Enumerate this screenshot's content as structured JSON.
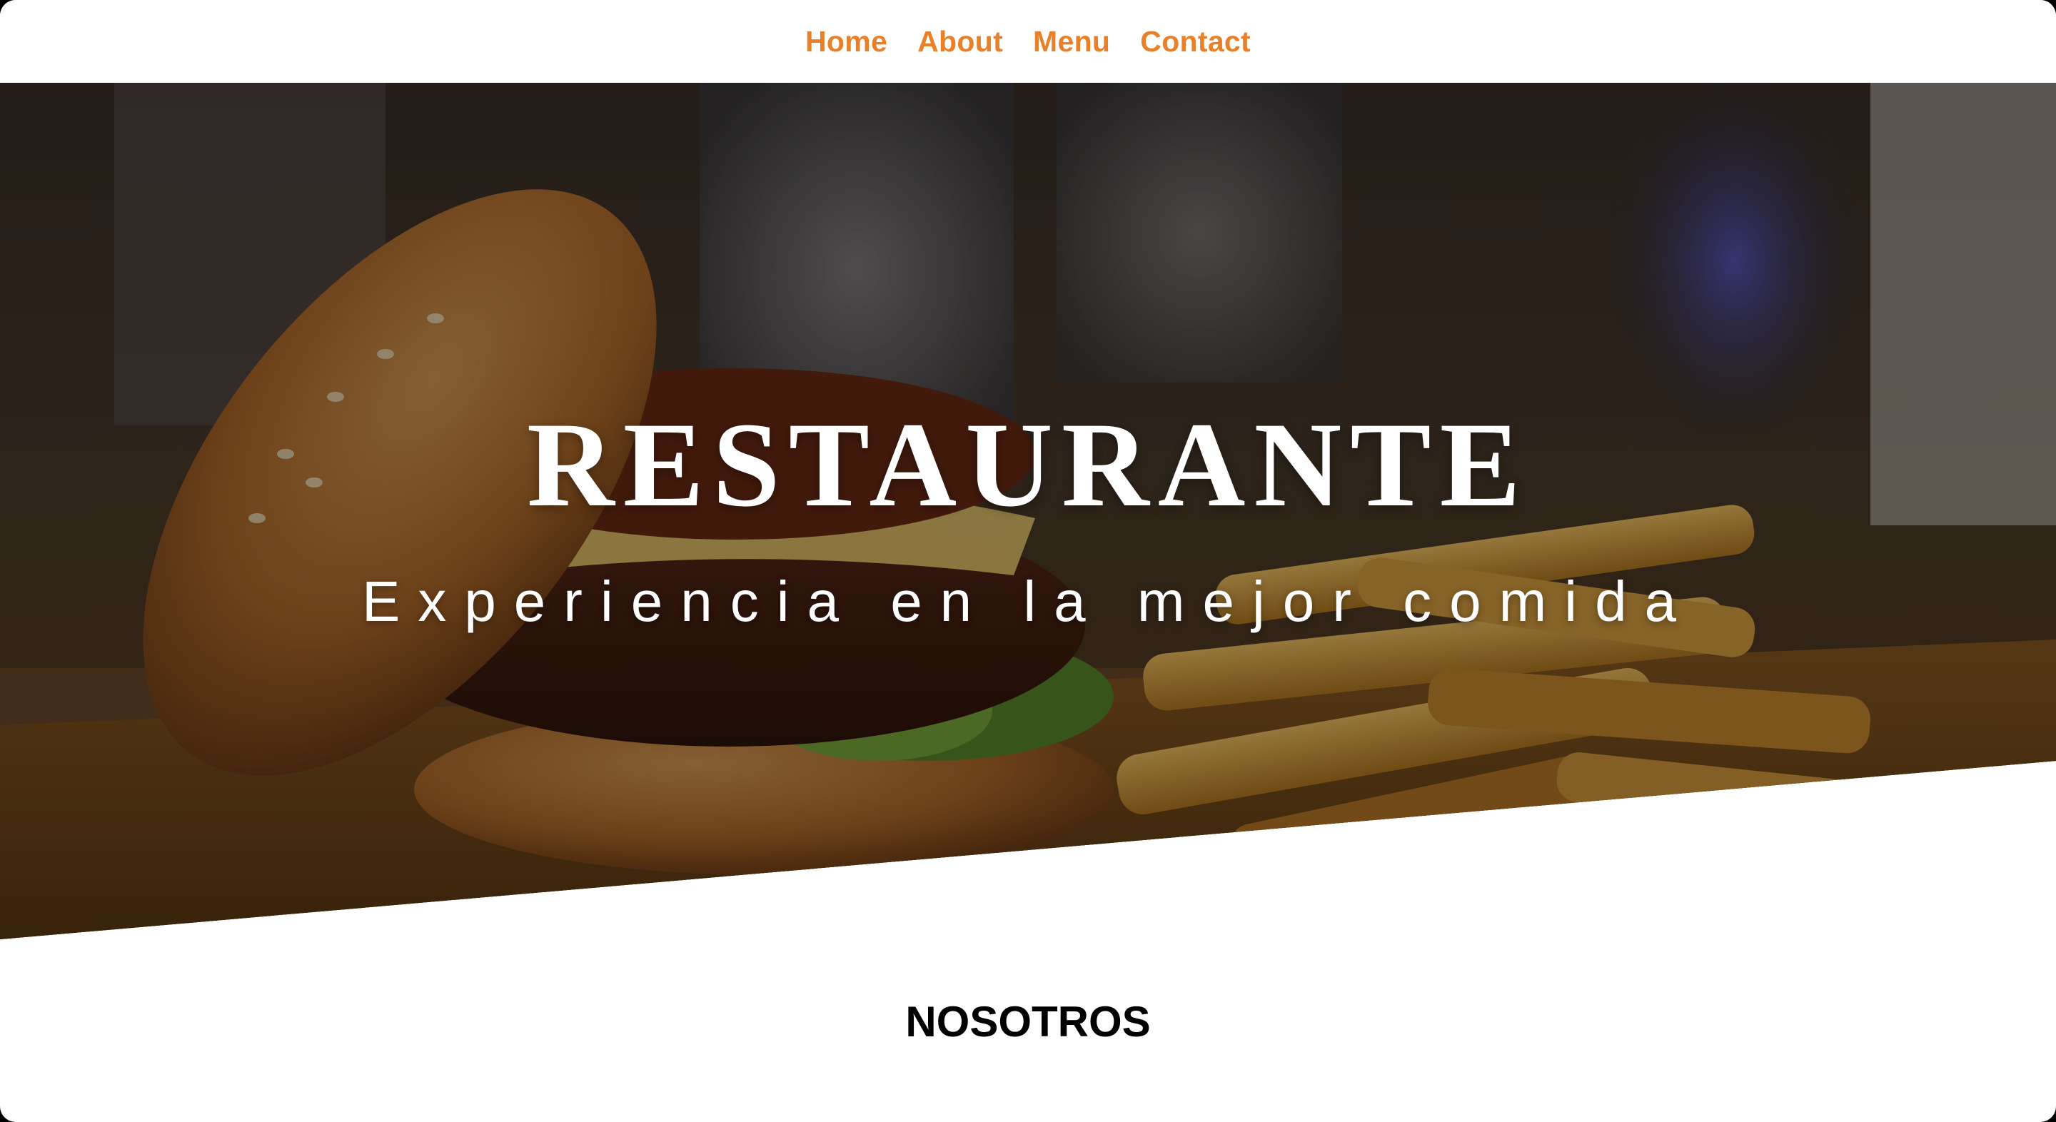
{
  "nav": {
    "items": [
      {
        "label": "Home"
      },
      {
        "label": "About"
      },
      {
        "label": "Menu"
      },
      {
        "label": "Contact"
      }
    ],
    "color": "#e8812a"
  },
  "hero": {
    "title": "RESTAURANTE",
    "subtitle": "Experiencia en la mejor comida",
    "background_image": "burger-and-fries-photo"
  },
  "section": {
    "title": "NOSOTROS"
  }
}
